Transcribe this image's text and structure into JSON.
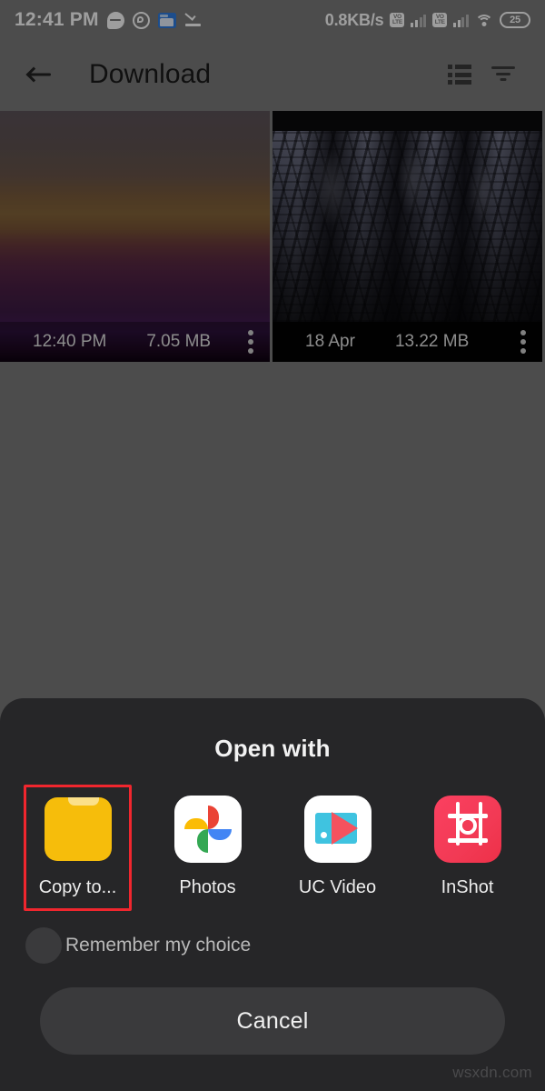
{
  "status_bar": {
    "clock": "12:41 PM",
    "network_speed": "0.8KB/s",
    "battery_level": "25",
    "volte_label_top": "VO",
    "volte_label_bottom": "LTE",
    "icons": [
      "message-bubble-icon",
      "whatsapp-icon",
      "file-manager-icon",
      "check-underline-icon",
      "volte-icon",
      "signal-bars-icon",
      "volte-icon",
      "signal-bars-icon",
      "wifi-icon",
      "battery-icon"
    ]
  },
  "toolbar": {
    "title": "Download",
    "back_icon": "back-arrow-icon",
    "list_view_icon": "list-view-icon",
    "filter_icon": "filter-icon"
  },
  "grid": {
    "items": [
      {
        "date": "12:40 PM",
        "size": "7.05 MB",
        "kind": "sunset-photo"
      },
      {
        "date": "18 Apr",
        "size": "13.22 MB",
        "kind": "forest-video"
      }
    ]
  },
  "sheet": {
    "title": "Open with",
    "apps": [
      {
        "label": "Copy to...",
        "icon": "folder-icon",
        "highlighted": true
      },
      {
        "label": "Photos",
        "icon": "google-photos-icon",
        "highlighted": false
      },
      {
        "label": "UC Video",
        "icon": "uc-video-icon",
        "highlighted": false
      },
      {
        "label": "InShot",
        "icon": "inshot-icon",
        "highlighted": false
      }
    ],
    "remember_label": "Remember my choice",
    "remember_checked": false,
    "cancel_label": "Cancel",
    "highlight_color": "#f0262e"
  },
  "watermark": "wsxdn.com"
}
